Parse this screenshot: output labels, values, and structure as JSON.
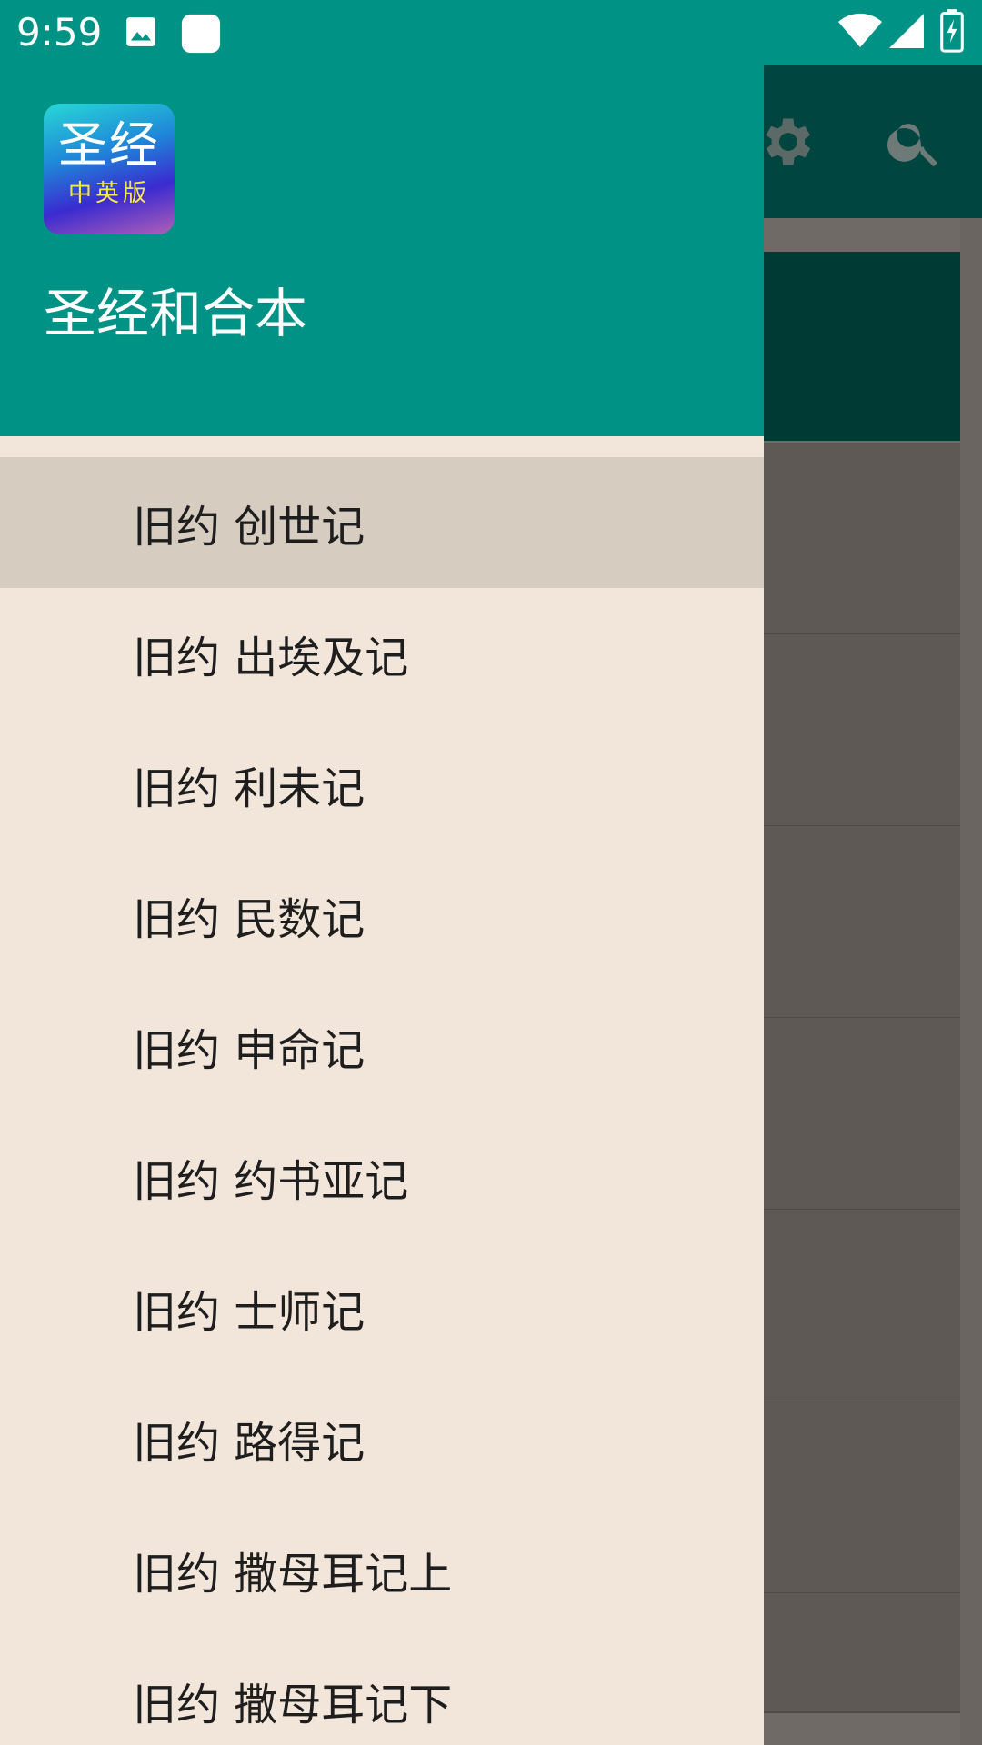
{
  "status_bar": {
    "time": "9:59",
    "icons": [
      "image-icon",
      "app-notification-icon",
      "wifi-icon",
      "cell-signal-icon",
      "battery-charging-icon"
    ]
  },
  "drawer": {
    "logo": {
      "title": "圣经",
      "subtitle": "中英版"
    },
    "title": "圣经和合本",
    "items": [
      {
        "label": "旧约 创世记",
        "active": true
      },
      {
        "label": "旧约 出埃及记"
      },
      {
        "label": "旧约 利未记"
      },
      {
        "label": "旧约 民数记"
      },
      {
        "label": "旧约 申命记"
      },
      {
        "label": "旧约 约书亚记"
      },
      {
        "label": "旧约 士师记"
      },
      {
        "label": "旧约 路得记"
      },
      {
        "label": "旧约 撒母耳记上"
      },
      {
        "label": "旧约 撒母耳记下"
      }
    ]
  },
  "background_app": {
    "toolbar_icons": [
      "settings-icon",
      "search-icon"
    ]
  },
  "colors": {
    "primary": "#009385",
    "drawer_bg": "#f2e6da",
    "active_item_bg": "#d6ccc0"
  }
}
